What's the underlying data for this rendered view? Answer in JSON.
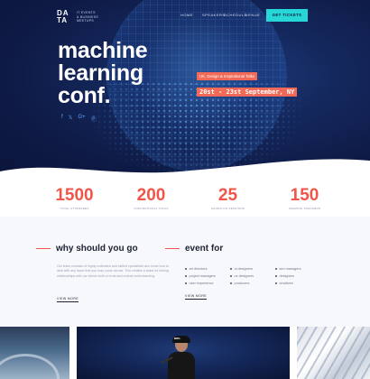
{
  "brand": {
    "mark": "DA TA",
    "tagline_lines": [
      "IT EVENTS",
      "& BUSINESS",
      "MEETUPS"
    ]
  },
  "nav": {
    "items": [
      "Home",
      "Speakers",
      "Schedule",
      "Venue"
    ],
    "cta": "GET TICKETS"
  },
  "hero": {
    "title_lines": [
      "machine",
      "learning",
      "conf."
    ],
    "badge_top": "UK, Design & Inspirational Talks",
    "badge_bottom": "20st - 23st September, NY",
    "social_icons": [
      "facebook-icon",
      "twitter-icon",
      "google-plus-icon",
      "pinterest-icon"
    ]
  },
  "stats": [
    {
      "number": "1500",
      "label": "Total Attendees"
    },
    {
      "number": "200",
      "label": "Inspirational Talks"
    },
    {
      "number": "25",
      "label": "Hands-on Sessions"
    },
    {
      "number": "150",
      "label": "Amazing Speakers"
    }
  ],
  "about": {
    "heading": "why should you go",
    "body": "Our team consists of highly motivated and skilled specialists who know how to deal with any issue that you may come across. This creates a basis for lasting relationships with our clients built on trust and mutual understanding.",
    "link": "VIEW MORE"
  },
  "audience": {
    "heading": "event for",
    "items": [
      "art directors",
      "ui designers",
      "seo managers",
      "project managers",
      "ux designers",
      "designers",
      "user experience",
      "producers",
      "creatives"
    ],
    "link": "VIEW MORE"
  },
  "photos": {
    "person_cap_text": "BRK."
  },
  "colors": {
    "accent": "#f0554a",
    "cta": "#27d6d6",
    "hero_bg": "#0e1a45"
  }
}
